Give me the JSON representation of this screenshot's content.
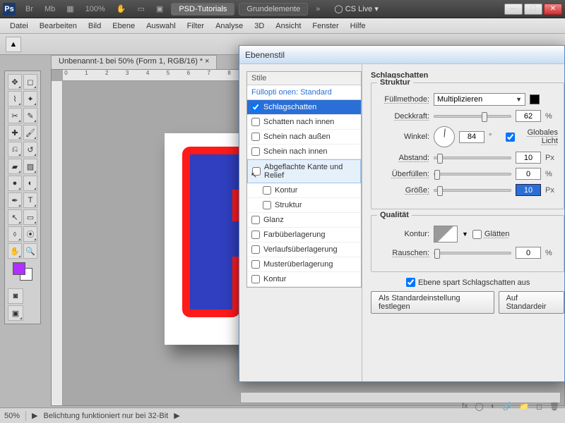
{
  "appbar": {
    "logo": "Ps",
    "br": "Br",
    "mb": "Mb",
    "zoom": "100%",
    "tutorials": "PSD-Tutorials",
    "grundel": "Grundelemente",
    "cslive": "CS Live"
  },
  "menu": [
    "Datei",
    "Bearbeiten",
    "Bild",
    "Ebene",
    "Auswahl",
    "Filter",
    "Analyse",
    "3D",
    "Ansicht",
    "Fenster",
    "Hilfe"
  ],
  "doctab": "Unbenannt-1 bei 50% (Form 1, RGB/16) *",
  "statusbar": {
    "zoom": "50%",
    "msg": "Belichtung funktioniert nur bei 32-Bit"
  },
  "dialog": {
    "title": "Ebenenstil",
    "styles_header": "Stile",
    "fill_options": "Füllopti onen: Standard",
    "styles": [
      {
        "label": "Schlagschatten",
        "checked": true,
        "selected": true
      },
      {
        "label": "Schatten nach innen",
        "checked": false
      },
      {
        "label": "Schein nach außen",
        "checked": false
      },
      {
        "label": "Schein nach innen",
        "checked": false
      },
      {
        "label": "Abgeflachte Kante und Relief",
        "checked": false,
        "hover": true
      },
      {
        "label": "Kontur",
        "checked": false,
        "sub": true
      },
      {
        "label": "Struktur",
        "checked": false,
        "sub": true
      },
      {
        "label": "Glanz",
        "checked": false
      },
      {
        "label": "Farbüberlagerung",
        "checked": false
      },
      {
        "label": "Verlaufsüberlagerung",
        "checked": false
      },
      {
        "label": "Musterüberlagerung",
        "checked": false
      },
      {
        "label": "Kontur",
        "checked": false
      }
    ],
    "section_title": "Schlagschatten",
    "struktur": {
      "legend": "Struktur",
      "fuellmethode_label": "Füllmethode:",
      "fuellmethode_value": "Multiplizieren",
      "deckkraft_label": "Deckkraft:",
      "deckkraft_value": "62",
      "deckkraft_unit": "%",
      "winkel_label": "Winkel:",
      "winkel_value": "84",
      "winkel_unit": "°",
      "global_label": "Globales Licht",
      "abstand_label": "Abstand:",
      "abstand_value": "10",
      "abstand_unit": "Px",
      "ueberfuellen_label": "Überfüllen:",
      "ueberfuellen_value": "0",
      "ueberfuellen_unit": "%",
      "groesse_label": "Größe:",
      "groesse_value": "10",
      "groesse_unit": "Px"
    },
    "qualitaet": {
      "legend": "Qualität",
      "kontur_label": "Kontur:",
      "glaetten_label": "Glätten",
      "rauschen_label": "Rauschen:",
      "rauschen_value": "0",
      "rauschen_unit": "%"
    },
    "spare_label": "Ebene spart Schlagschatten aus",
    "btn_default": "Als Standardeinstellung festlegen",
    "btn_reset": "Auf Standardeir"
  },
  "colors": {
    "fg": "#b030ff",
    "bg": "#ffffff",
    "letter_fill": "#2f3fbf",
    "letter_stroke": "#ff1a1a"
  }
}
